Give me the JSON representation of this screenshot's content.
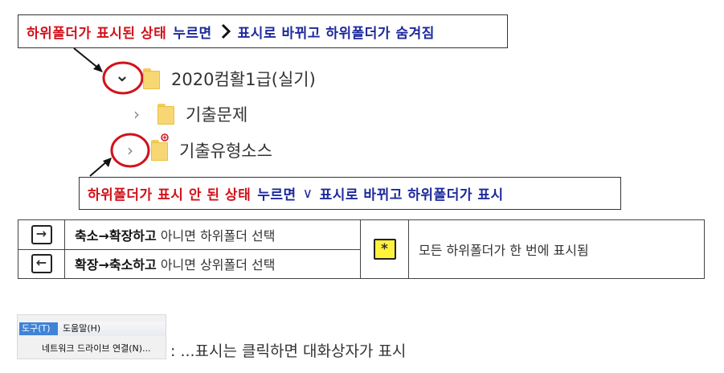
{
  "callout_top": {
    "part1": "하위폴더가 표시된 상태",
    "part2": "누르면",
    "part3": "표시로 바뀌고 하위폴더가 숨겨짐"
  },
  "callout_bottom": {
    "part1": "하위폴더가 표시 안 된 상태",
    "part2": "누르면",
    "part3": "∨",
    "part4": "표시로 바뀌고 하위폴더가 표시"
  },
  "tree": {
    "expanded_chevron": "⌄",
    "collapsed_chevron": "›",
    "root": "2020컴활1급(실기)",
    "child1": "기출문제",
    "child2": "기출유형소스"
  },
  "keys_table": {
    "row1_key": "→",
    "row1_bold": "축소→확장하고",
    "row1_rest": "아니면 하위폴더 선택",
    "row2_key": "←",
    "row2_bold": "확장→축소하고",
    "row2_rest": "아니면 상위폴더 선택",
    "star_key": "*",
    "star_desc": "모든 하위폴더가 한 번에 표시됨"
  },
  "menu": {
    "tools": "도구(T)",
    "help": "도움말(H)",
    "item": "네트워크 드라이브 연결(N)..."
  },
  "menu_note": ": ...표시는 클릭하면 대화상자가 표시"
}
